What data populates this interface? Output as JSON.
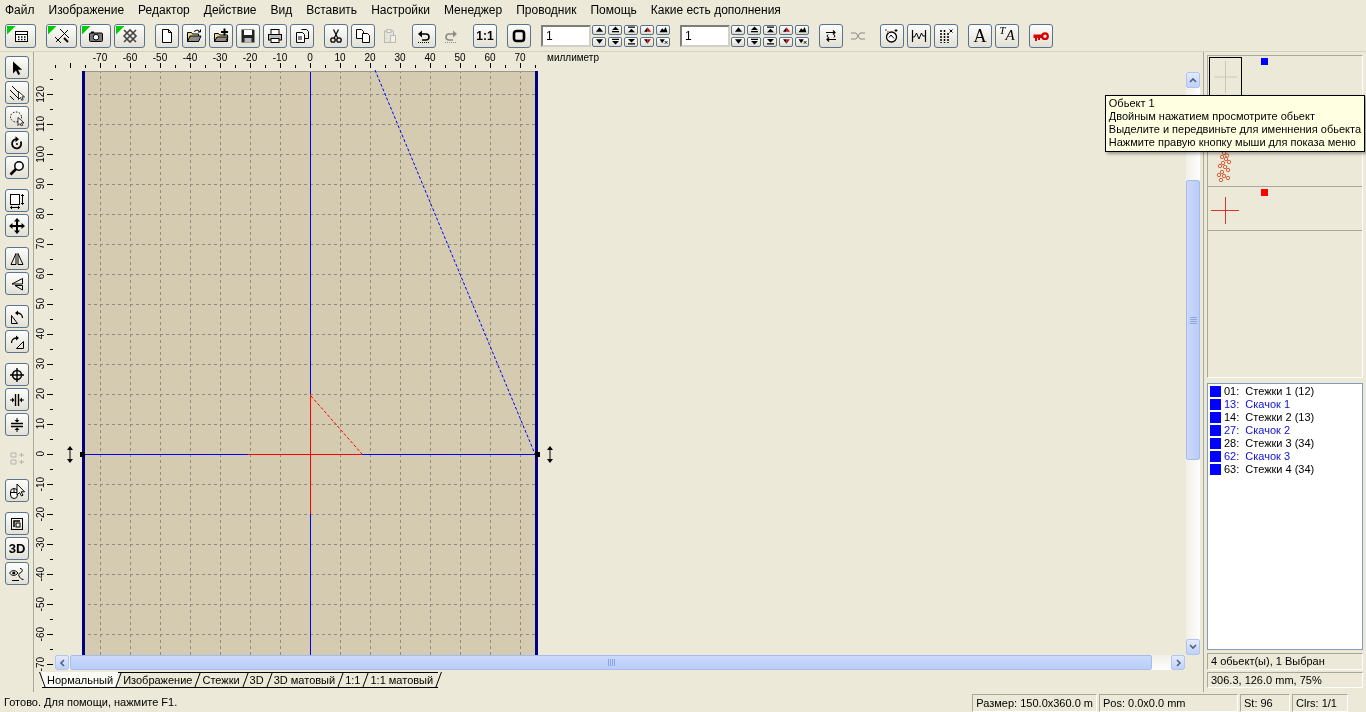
{
  "menu": [
    "Файл",
    "Изображение",
    "Редактор",
    "Действие",
    "Вид",
    "Вставить",
    "Настройки",
    "Менеджер",
    "Проводник",
    "Помощь",
    "Какие есть дополнения"
  ],
  "toolbar": [
    [
      {
        "kind": "designs",
        "marked": true,
        "disabled": false
      }
    ],
    [
      {
        "kind": "stitches",
        "marked": true,
        "disabled": false
      },
      {
        "kind": "camera",
        "marked": true,
        "disabled": false
      },
      {
        "kind": "crossgrid",
        "marked": true,
        "disabled": false
      }
    ],
    [
      {
        "kind": "new",
        "disabled": false
      },
      {
        "kind": "open",
        "disabled": false
      },
      {
        "kind": "import",
        "disabled": false
      },
      {
        "kind": "save",
        "disabled": false
      },
      {
        "kind": "print",
        "disabled": false
      },
      {
        "kind": "export",
        "disabled": false
      }
    ],
    [
      {
        "kind": "cut",
        "disabled": false
      },
      {
        "kind": "copy",
        "disabled": false
      },
      {
        "kind": "paste",
        "disabled": true
      }
    ],
    [
      {
        "kind": "undo",
        "disabled": false
      },
      {
        "kind": "redo",
        "disabled": true
      }
    ],
    [
      {
        "kind": "ratio",
        "label": "1:1",
        "disabled": false
      }
    ],
    [
      {
        "kind": "frame",
        "disabled": false
      }
    ],
    [
      {
        "kind": "counter",
        "value": "1"
      }
    ],
    [
      {
        "kind": "counter",
        "value": "1"
      }
    ],
    [
      {
        "kind": "swap",
        "disabled": false
      },
      {
        "kind": "join",
        "disabled": true
      }
    ],
    [
      {
        "kind": "magic",
        "disabled": false
      },
      {
        "kind": "wave",
        "disabled": false
      },
      {
        "kind": "bars",
        "disabled": false
      }
    ],
    [
      {
        "kind": "text",
        "label": "A",
        "disabled": false
      },
      {
        "kind": "textpath",
        "label": "$^{T}$A",
        "disabled": false
      }
    ],
    [
      {
        "kind": "key",
        "disabled": false
      }
    ]
  ],
  "tools": [
    [
      {
        "kind": "select",
        "disabled": false
      },
      {
        "kind": "stitchtool",
        "disabled": false
      },
      {
        "kind": "lasso",
        "disabled": false
      },
      {
        "kind": "rotate",
        "disabled": false
      },
      {
        "kind": "zoom",
        "disabled": false
      }
    ],
    [
      {
        "kind": "resize",
        "disabled": false
      },
      {
        "kind": "move",
        "disabled": false
      }
    ],
    [
      {
        "kind": "mirrorh",
        "disabled": false
      },
      {
        "kind": "mirrorv",
        "disabled": false
      }
    ],
    [
      {
        "kind": "rotleft",
        "disabled": false
      },
      {
        "kind": "rotright",
        "disabled": false
      }
    ],
    [
      {
        "kind": "center",
        "disabled": false
      },
      {
        "kind": "alignh",
        "disabled": false
      },
      {
        "kind": "alignv",
        "disabled": false
      }
    ],
    [
      {
        "kind": "order",
        "disabled": true
      }
    ],
    [
      {
        "kind": "pointer",
        "disabled": false
      }
    ],
    [
      {
        "kind": "square",
        "disabled": false
      },
      {
        "kind": "threed",
        "label": "3D",
        "disabled": false
      },
      {
        "kind": "eye",
        "disabled": false
      }
    ]
  ],
  "ruler": {
    "x_labels": [
      "-70",
      "-60",
      "-50",
      "-40",
      "-30",
      "-20",
      "-10",
      "0",
      "10",
      "20",
      "30",
      "40",
      "50",
      "60",
      "70"
    ],
    "unit": "миллиметр",
    "y_labels": [
      "120",
      "110",
      "100",
      "90",
      "80",
      "70",
      "60",
      "50",
      "40",
      "30",
      "20",
      "10",
      "0",
      "-10",
      "-20",
      "-30",
      "-40",
      "-50",
      "-60",
      "-70"
    ]
  },
  "tabs": [
    {
      "label": "Нормальный",
      "selected": true
    },
    {
      "label": "Изображение",
      "selected": false
    },
    {
      "label": "Стежки",
      "selected": false
    },
    {
      "label": "3D",
      "selected": false
    },
    {
      "label": "3D матовый",
      "selected": false
    },
    {
      "label": "1:1",
      "selected": false
    },
    {
      "label": "1:1 матовый",
      "selected": false
    }
  ],
  "thumbnails": [
    {
      "kind": "outline",
      "selected": true,
      "color": "#0000ff"
    },
    {
      "kind": "pattern",
      "selected": false
    },
    {
      "kind": "cross",
      "selected": false,
      "color": "#ff0000"
    }
  ],
  "tooltip": [
    "Обьект 1",
    "Двойным нажатием просмотрите обьект",
    "Выделите и передвиньте для именнения обьекта",
    "Нажмите правую кнопку мыши для показа меню"
  ],
  "stitch_list": [
    {
      "kind": "stitch",
      "number": "01:",
      "label": "Стежки 1 (12)",
      "color": "#0000ff"
    },
    {
      "kind": "jump",
      "number": "13:",
      "label": "Скачок 1",
      "color": "#0000ff"
    },
    {
      "kind": "stitch",
      "number": "14:",
      "label": "Стежки 2 (13)",
      "color": "#0000ff"
    },
    {
      "kind": "jump",
      "number": "27:",
      "label": "Скачок 2",
      "color": "#0000ff"
    },
    {
      "kind": "stitch",
      "number": "28:",
      "label": "Стежки 3 (34)",
      "color": "#0000ff"
    },
    {
      "kind": "jump",
      "number": "62:",
      "label": "Скачок 3",
      "color": "#0000ff"
    },
    {
      "kind": "stitch",
      "number": "63:",
      "label": "Стежки 4 (34)",
      "color": "#0000ff"
    }
  ],
  "info": [
    "4 обьект(ы), 1 Выбран",
    "306.3, 126.0 mm, 75%"
  ],
  "status_bar": {
    "text": "Готово. Для помощи, нажмите F1.",
    "panes": [
      "Размер: 150.0x360.0 m",
      "Pos: 0.0x0.0 mm",
      "St: 96",
      "Clrs: 1/1"
    ]
  }
}
